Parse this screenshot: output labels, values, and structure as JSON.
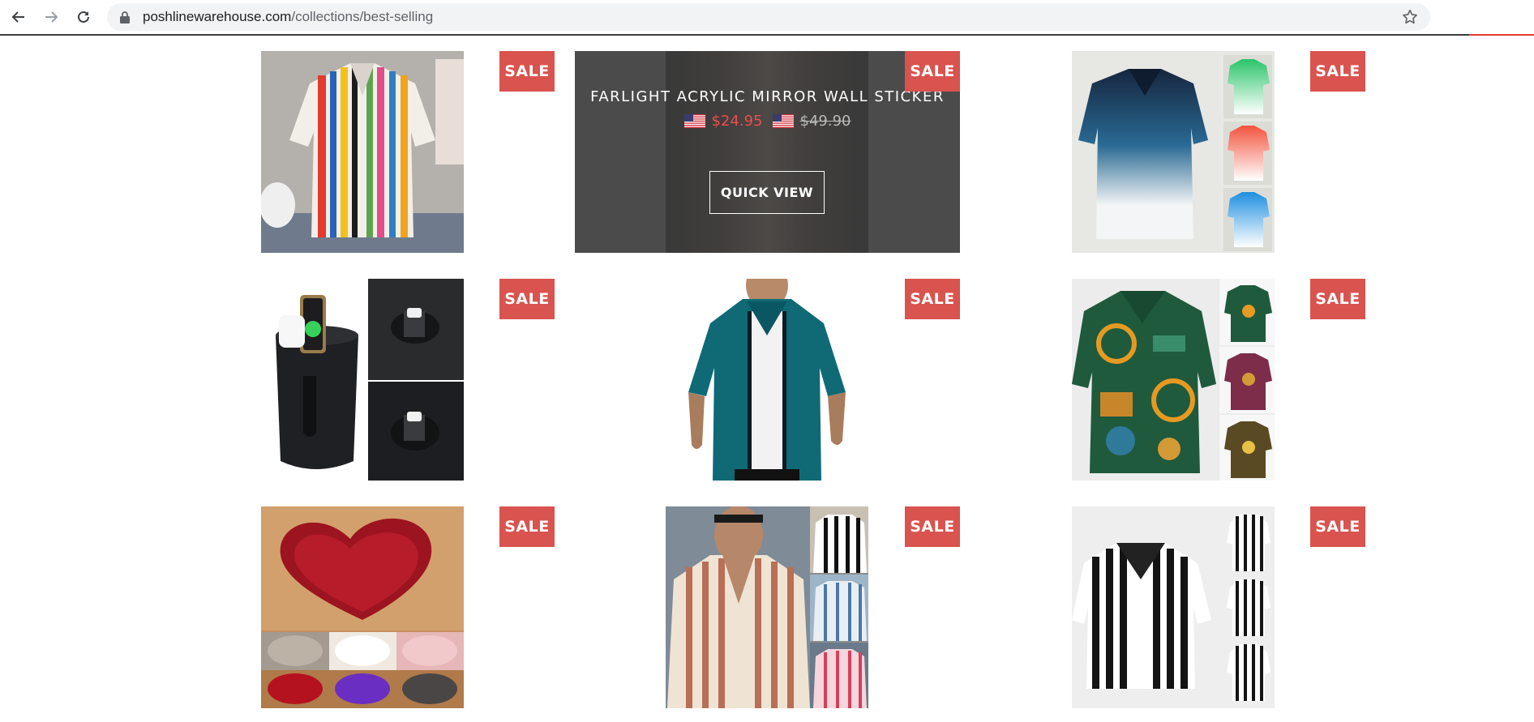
{
  "browser": {
    "url_domain": "poshlinewarehouse.com",
    "url_path": "/collections/best-selling",
    "back_icon": "arrow-left-icon",
    "forward_icon": "arrow-right-icon",
    "reload_icon": "reload-icon",
    "lock_icon": "lock-icon",
    "bookmark_icon": "star-icon"
  },
  "colors": {
    "sale_badge": "#d9534f",
    "sale_price": "#e94f4f",
    "overlay": "#3c3c3c"
  },
  "products": [
    {
      "image": "multicolor-striped-shirt",
      "badge": "SALE"
    },
    {
      "image": "mirror-wall-sticker",
      "badge": "SALE",
      "title": "FARLIGHT ACRYLIC MIRROR WALL STICKER",
      "sale_price": "$24.95",
      "compare_price": "$49.90",
      "currency_icon": "us-flag-icon",
      "quick_view_label": "QUICK VIEW"
    },
    {
      "image": "navy-gradient-shirt",
      "badge": "SALE"
    },
    {
      "image": "car-cup-wireless-charger",
      "badge": "SALE"
    },
    {
      "image": "teal-white-stripe-shirt",
      "badge": "SALE"
    },
    {
      "image": "green-ethnic-print-shirt",
      "badge": "SALE"
    },
    {
      "image": "heart-fur-rug",
      "badge": "SALE"
    },
    {
      "image": "beige-stripe-shirt",
      "badge": "SALE"
    },
    {
      "image": "black-white-stripe-shirt",
      "badge": "SALE"
    }
  ]
}
